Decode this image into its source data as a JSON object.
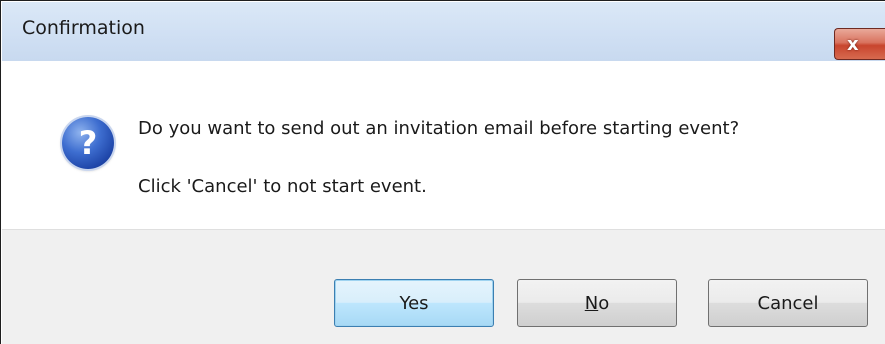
{
  "window": {
    "title": "Confirmation",
    "close_glyph": "x"
  },
  "message": {
    "icon": "question-icon",
    "icon_glyph": "?",
    "main": "Do you want to send out an invitation email before starting event?",
    "sub": "Click 'Cancel' to not start event."
  },
  "buttons": {
    "yes": "Yes",
    "no_mnemonic": "N",
    "no_rest": "o",
    "cancel": "Cancel"
  },
  "colors": {
    "title_bar": "#cfdff3",
    "close_button": "#c8452e",
    "footer": "#f0f0f0",
    "default_button_border": "#3c7fb1",
    "icon_blue": "#1e45a8"
  }
}
